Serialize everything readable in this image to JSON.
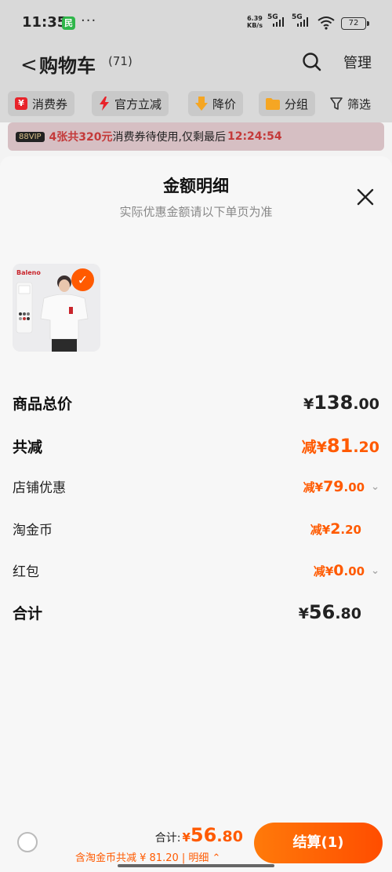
{
  "status_bar": {
    "time": "11:35",
    "app_icon_letter": "民",
    "more": "···",
    "speed_value": "6.39",
    "speed_unit": "KB/s",
    "net1": "5G",
    "net2": "5G",
    "battery": "72"
  },
  "header": {
    "back_symbol": "<",
    "title": "购物车",
    "count": "(71)",
    "manage_label": "管理"
  },
  "filters": [
    {
      "label": "消费券",
      "icon": "coupon-icon",
      "color": "#e8232a"
    },
    {
      "label": "官方立减",
      "icon": "lightning-icon",
      "color": "#e8232a"
    },
    {
      "label": "降价",
      "icon": "down-arrow-icon",
      "color": "#f5a623"
    },
    {
      "label": "分组",
      "icon": "folder-icon",
      "color": "#f5a623"
    },
    {
      "label": "筛选",
      "icon": "filter-icon",
      "color": "#333333"
    }
  ],
  "vip_banner": {
    "tag": "88VIP",
    "highlight": "4张共320元",
    "text": "消费券待使用,仅剩最后",
    "countdown": "12:24:54"
  },
  "sheet": {
    "title": "金额明细",
    "subtitle": "实际优惠金额请以下单页为准",
    "product_brand": "Baleno",
    "rows": {
      "total": {
        "label": "商品总价",
        "currency": "¥",
        "int": "138",
        "dec": ".00"
      },
      "discount": {
        "label": "共减",
        "prefix": "减",
        "currency": "¥",
        "int": "81",
        "dec": ".20"
      },
      "shop": {
        "label": "店铺优惠",
        "prefix": "减",
        "currency": "¥",
        "int": "79",
        "dec": ".00"
      },
      "coin": {
        "label": "淘金币",
        "prefix": "减",
        "currency": "¥",
        "int": "2",
        "dec": ".20"
      },
      "redpack": {
        "label": "红包",
        "prefix": "减",
        "currency": "¥",
        "int": "0",
        "dec": ".00"
      },
      "sum": {
        "label": "合计",
        "currency": "¥",
        "int": "56",
        "dec": ".80"
      }
    }
  },
  "bottom_bar": {
    "total_label": "合计:",
    "currency": "¥",
    "total_int": "56",
    "total_dec": ".80",
    "sub_text": "含淘金币共减 ¥ 81.20 | 明细",
    "checkout_label": "结算(1)"
  },
  "colors": {
    "accent": "#ff5a00",
    "dim_bg": "#d9d9d9"
  }
}
